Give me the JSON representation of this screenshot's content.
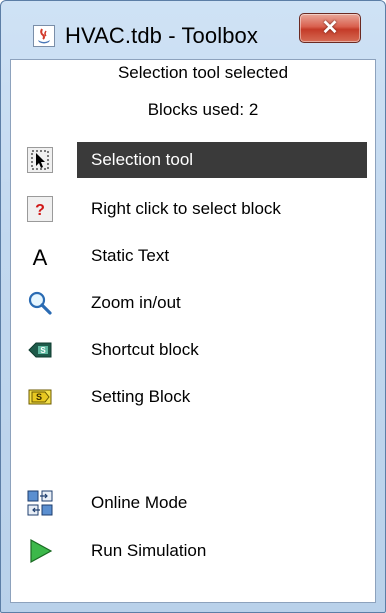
{
  "window": {
    "title": "HVAC.tdb - Toolbox",
    "close_label": "✕"
  },
  "status": {
    "text": "Selection tool selected",
    "blocks_used": "Blocks used: 2"
  },
  "tools": [
    {
      "label": "Selection tool",
      "icon": "selection-arrow-icon",
      "selected": true
    },
    {
      "label": "Right click to select block",
      "icon": "question-mark-icon",
      "selected": false
    },
    {
      "label": "Static Text",
      "icon": "text-a-icon",
      "selected": false
    },
    {
      "label": "Zoom in/out",
      "icon": "magnifier-icon",
      "selected": false
    },
    {
      "label": "Shortcut block",
      "icon": "shortcut-block-icon",
      "selected": false
    },
    {
      "label": "Setting Block",
      "icon": "setting-block-icon",
      "selected": false
    },
    {
      "label": "Online Mode",
      "icon": "online-mode-icon",
      "selected": false
    },
    {
      "label": "Run Simulation",
      "icon": "play-icon",
      "selected": false
    }
  ],
  "colors": {
    "selected_bg": "#3a3a3a",
    "title_bar": "#c2d8ef",
    "close_button": "#c43b28"
  }
}
